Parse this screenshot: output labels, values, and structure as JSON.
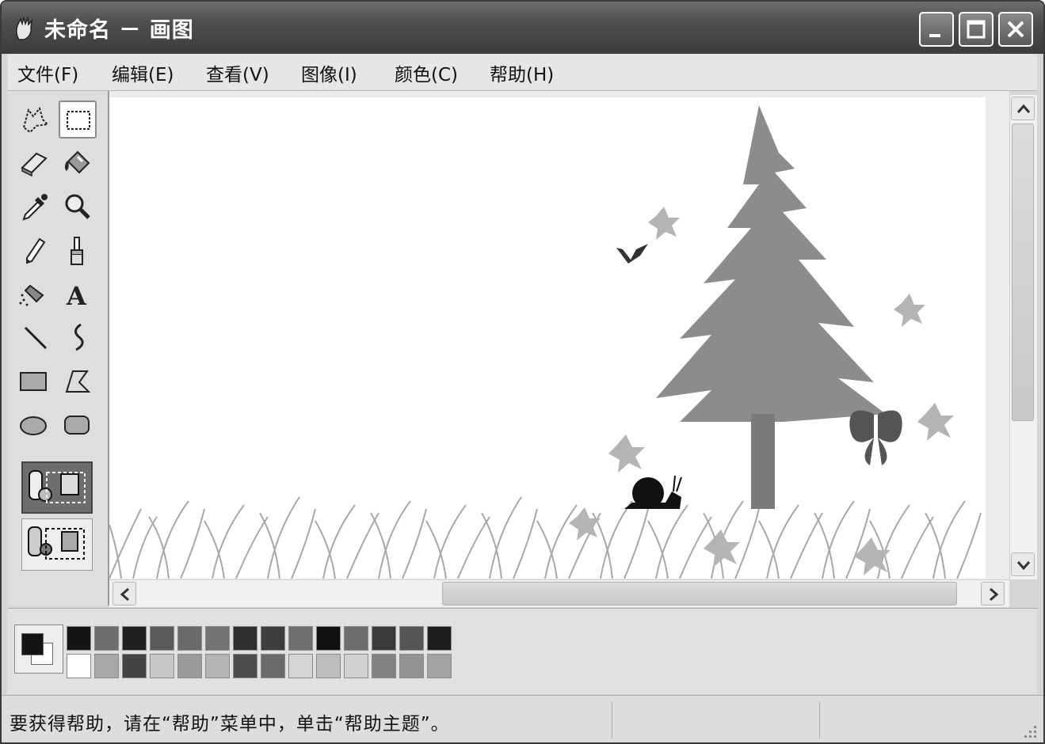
{
  "window": {
    "title": "未命名 － 画图"
  },
  "menu": [
    "文件(F)",
    "编辑(E)",
    "查看(V)",
    "图像(I)",
    "颜色(C)",
    "帮助(H)"
  ],
  "tools": [
    {
      "name": "free-form-select-icon"
    },
    {
      "name": "rectangle-select-icon",
      "selected": true
    },
    {
      "name": "eraser-icon"
    },
    {
      "name": "fill-bucket-icon"
    },
    {
      "name": "pick-color-icon"
    },
    {
      "name": "magnifier-icon"
    },
    {
      "name": "pencil-icon"
    },
    {
      "name": "brush-icon"
    },
    {
      "name": "airbrush-icon"
    },
    {
      "name": "text-icon",
      "glyph": "A"
    },
    {
      "name": "line-icon"
    },
    {
      "name": "curve-icon"
    },
    {
      "name": "rectangle-icon"
    },
    {
      "name": "polygon-icon"
    },
    {
      "name": "ellipse-icon"
    },
    {
      "name": "rounded-rectangle-icon"
    }
  ],
  "selection_options": [
    "opaque-selection-icon",
    "transparent-selection-icon"
  ],
  "palette": {
    "foreground": "#151515",
    "background": "#ffffff",
    "row1": [
      "#151515",
      "#6e6e6e",
      "#202020",
      "#5a5a5a",
      "#6a6a6a",
      "#737373",
      "#2f2f2f",
      "#3d3d3d",
      "#707070",
      "#111111",
      "#6d6d6d",
      "#3a3a3a",
      "#555555",
      "#1e1e1e"
    ],
    "row2": [
      "#ffffff",
      "#a8a8a8",
      "#444444",
      "#c8c8c8",
      "#9a9a9a",
      "#b4b4b4",
      "#4d4d4d",
      "#6b6b6b",
      "#d5d5d5",
      "#bdbdbd",
      "#d0d0d0",
      "#828282",
      "#939393",
      "#a3a3a3"
    ]
  },
  "status": {
    "help_text": "要获得帮助，请在“帮助”菜单中，单击“帮助主题”。"
  }
}
